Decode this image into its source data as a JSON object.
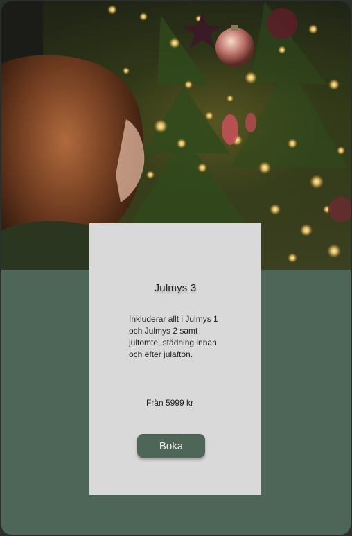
{
  "hero": {
    "image_alt": "Child looking at a decorated Christmas tree"
  },
  "card": {
    "title": "Julmys 3",
    "description": "Inkluderar allt i Julmys 1 och Julmys 2 samt jultomte, städning innan och efter julafton.",
    "price": "Från 5999 kr",
    "button_label": "Boka"
  },
  "colors": {
    "background": "#4e6657",
    "card": "#d9d9d9",
    "button": "#4e6657",
    "button_text": "#f2f2f2"
  }
}
